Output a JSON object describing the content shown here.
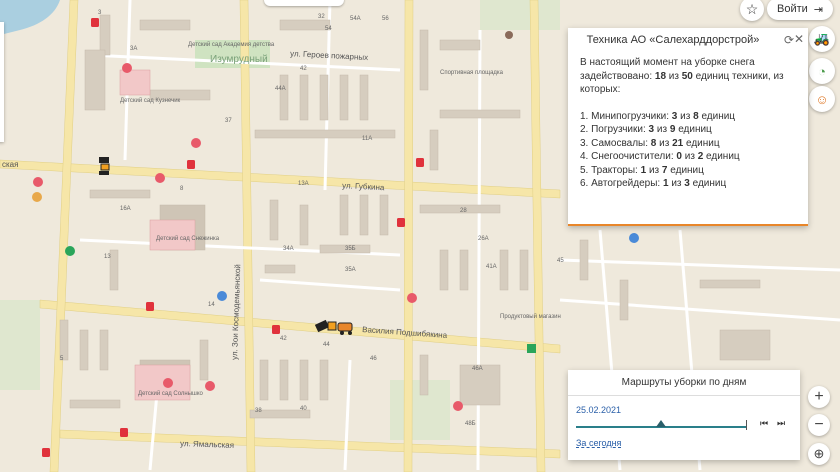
{
  "map": {
    "streets": {
      "geroev": "ул. Героев пожарных",
      "gubkina": "ул. Губкина",
      "podshibyakina": "Василия Подшибякина",
      "yamalskaya": "ул. Ямальская",
      "kosmodemyanskoy": "ул. Зои Космодемьянской",
      "kaskaya": "ская"
    },
    "district": "Изумрудный",
    "pois": {
      "kindergarten1": "Детский сад Кузнечик",
      "kindergarten2": "Детский сад Академия детства",
      "school": "Детский сад Снежинка",
      "sports": "Спортивная площадка",
      "kindergarten3": "Детский сад Солнышко",
      "shop": "Продуктовый магазин"
    },
    "house_numbers": {
      "h1": "32",
      "h2": "54",
      "h3": "54А",
      "h4": "56",
      "h5": "3",
      "h6": "3А",
      "h7": "42",
      "h8": "44А",
      "h9": "37",
      "h10": "11А",
      "h11": "8",
      "h12": "16А",
      "h13": "13",
      "h14": "34А",
      "h15": "35Б",
      "h16": "35А",
      "h17": "28",
      "h18": "26А",
      "h19": "41А",
      "h20": "45",
      "h21": "13А",
      "h22": "44",
      "h23": "46",
      "h24": "42",
      "h25": "46А",
      "h26": "40",
      "h27": "48Б",
      "h28": "5",
      "h29": "14",
      "h30": "38"
    }
  },
  "header": {
    "login_label": "Войти",
    "star_icon": "star-icon",
    "login_icon": "login-arrow-icon"
  },
  "info_panel": {
    "title": "Техника АО «Салехарддорстрой»",
    "intro_line1": "В настоящий момент на уборке снега",
    "intro_line2a": "задействовано:",
    "intro_engaged": "18",
    "intro_of": "из",
    "intro_total": "50",
    "intro_line2b": "единиц техники, из",
    "intro_line3": "которых:",
    "items": [
      {
        "label": "1. Минипогрузчики:",
        "used": "3",
        "of": "из",
        "total": "8",
        "unit": "единиц"
      },
      {
        "label": "2. Погрузчики:",
        "used": "3",
        "of": "из",
        "total": "9",
        "unit": "единиц"
      },
      {
        "label": "3. Самосвалы:",
        "used": "8",
        "of": "из",
        "total": "21",
        "unit": "единиц"
      },
      {
        "label": "4. Снегоочистители:",
        "used": "0",
        "of": "из",
        "total": "2",
        "unit": "единиц"
      },
      {
        "label": "5. Тракторы:",
        "used": "1",
        "of": "из",
        "total": "7",
        "unit": "единиц"
      },
      {
        "label": "6. Автогрейдеры:",
        "used": "1",
        "of": "из",
        "total": "3",
        "unit": "единиц"
      }
    ]
  },
  "routes_panel": {
    "title": "Маршруты уборки по дням",
    "date": "25.02.2021",
    "today_link": "За сегодня",
    "progress": 0.5
  },
  "colors": {
    "accent": "#e8862a",
    "link": "#2a5fa8",
    "road": "#ffffff",
    "main_road": "#f6e6a8",
    "block": "#e4ddd0",
    "building": "#d6cdbf",
    "park": "#cfe3c1"
  }
}
